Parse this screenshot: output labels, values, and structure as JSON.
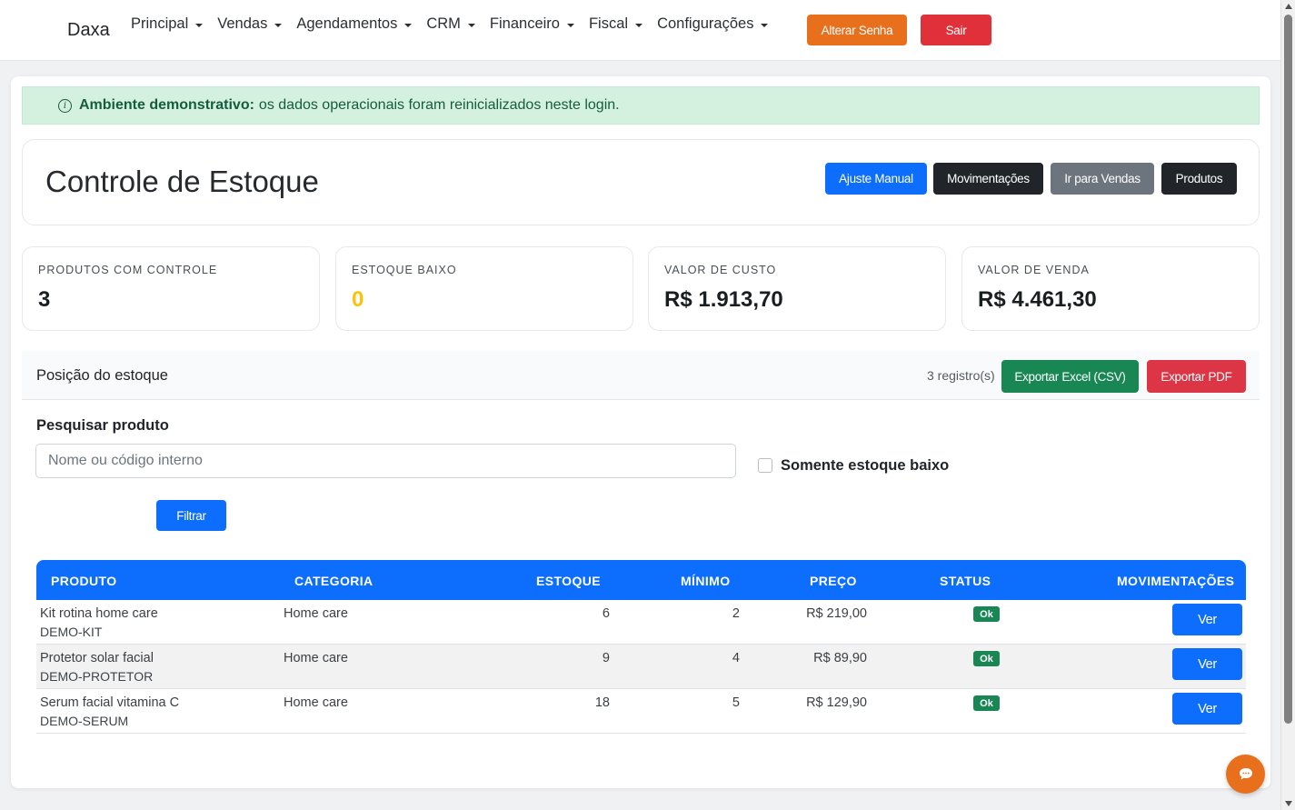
{
  "navbar": {
    "brand": "Daxa",
    "menu": [
      "Principal",
      "Vendas",
      "Agendamentos",
      "CRM",
      "Financeiro",
      "Fiscal",
      "Configurações"
    ],
    "change_password": "Alterar Senha",
    "logout": "Sair"
  },
  "alert": {
    "bold": "Ambiente demonstrativo:",
    "text": "os dados operacionais foram reinicializados neste login."
  },
  "header": {
    "title": "Controle de Estoque",
    "buttons": {
      "adjust": "Ajuste Manual",
      "moves": "Movimentações",
      "sales": "Ir para Vendas",
      "products": "Produtos"
    }
  },
  "stats": [
    {
      "label": "PRODUTOS COM CONTROLE",
      "value": "3"
    },
    {
      "label": "ESTOQUE BAIXO",
      "value": "0"
    },
    {
      "label": "VALOR DE CUSTO",
      "value": "R$ 1.913,70"
    },
    {
      "label": "VALOR DE VENDA",
      "value": "R$ 4.461,30"
    }
  ],
  "panel": {
    "title": "Posição do estoque",
    "count": "3 registro(s)",
    "export_excel": "Exportar Excel (CSV)",
    "export_pdf": "Exportar PDF",
    "search_label": "Pesquisar produto",
    "search_placeholder": "Nome ou código interno",
    "search_value": "",
    "low_stock_label": "Somente estoque baixo",
    "filter": "Filtrar"
  },
  "table": {
    "headers": [
      "PRODUTO",
      "CATEGORIA",
      "ESTOQUE",
      "MÍNIMO",
      "PREÇO",
      "STATUS",
      "MOVIMENTAÇÕES"
    ],
    "rows": [
      {
        "name": "Kit rotina home care",
        "code": "DEMO-KIT",
        "category": "Home care",
        "stock": "6",
        "min": "2",
        "price": "R$ 219,00",
        "status": "Ok",
        "action": "Ver"
      },
      {
        "name": "Protetor solar facial",
        "code": "DEMO-PROTETOR",
        "category": "Home care",
        "stock": "9",
        "min": "4",
        "price": "R$ 89,90",
        "status": "Ok",
        "action": "Ver"
      },
      {
        "name": "Serum facial vitamina C",
        "code": "DEMO-SERUM",
        "category": "Home care",
        "stock": "18",
        "min": "5",
        "price": "R$ 129,90",
        "status": "Ok",
        "action": "Ver"
      }
    ]
  },
  "colors": {
    "primary": "#0d6efd",
    "dark": "#212529",
    "secondary": "#6c757d",
    "success": "#198754",
    "danger": "#dc3545",
    "warning_value": "#ffc107",
    "orange": "#e8701c"
  },
  "icons": {
    "alert": "info-icon",
    "chat": "chat-icon"
  }
}
